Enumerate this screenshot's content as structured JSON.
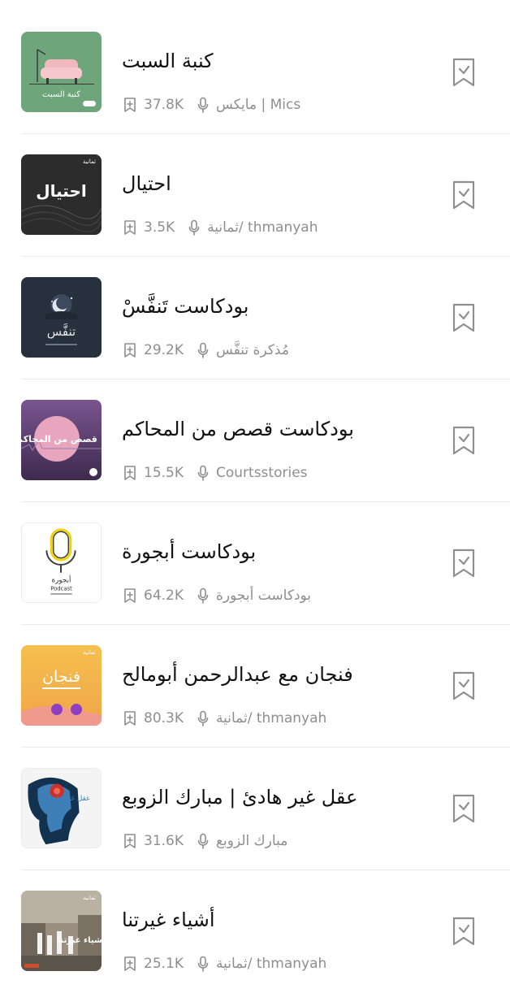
{
  "podcasts": [
    {
      "title": "كنبة السبت",
      "saves": "37.8K",
      "author": "مايكس | Mics",
      "cover": {
        "icon": "sofa-cover-art",
        "bg": "#6fa57b",
        "text": "كنبة السبت"
      }
    },
    {
      "title": "احتيال",
      "saves": "3.5K",
      "author": "ثمانية/ thmanyah",
      "cover": {
        "icon": "fingerprint-cover-art",
        "bg": "#2c2c2c",
        "text": "احتيال",
        "badge": "ثمانية"
      }
    },
    {
      "title": "بودكاست تَنفَّسْ",
      "saves": "29.2K",
      "author": "مُذكرة تنفَّس",
      "cover": {
        "icon": "moon-cover-art",
        "bg": "#27313d",
        "text": "تنفَّس"
      }
    },
    {
      "title": "بودكاست قصص من المحاكم",
      "saves": "15.5K",
      "author": "Courtsstories",
      "cover": {
        "icon": "purple-circle-cover-art",
        "bg": "#5b3f6e",
        "text": "قصص من المحاكم"
      }
    },
    {
      "title": "بودكاست أبجورة",
      "saves": "64.2K",
      "author": "بودكاست أبجورة",
      "cover": {
        "icon": "microphone-cover-art",
        "bg": "#ffffff",
        "text": "أبجورة",
        "subtext": "Podcast"
      }
    },
    {
      "title": "فنجان مع عبدالرحمن أبومالح",
      "saves": "80.3K",
      "author": "ثمانية/ thmanyah",
      "cover": {
        "icon": "fenjan-cover-art",
        "bg": "#f3b94f",
        "text": "فنجان",
        "badge": "ثمانية"
      }
    },
    {
      "title": "عقل غير هادئ | مبارك الزوبع",
      "saves": "31.6K",
      "author": "مبارك الزوبع",
      "cover": {
        "icon": "xray-skull-cover-art",
        "bg": "#f4f4f4",
        "text": "عقل غير هادئ"
      }
    },
    {
      "title": "أشياء غيرتنا",
      "saves": "25.1K",
      "author": "ثمانية/ thmanyah",
      "cover": {
        "icon": "street-photo-cover-art",
        "bg": "#9a8f80",
        "text": "أشياء غيرتنا",
        "badge": "ثمانية"
      }
    }
  ],
  "colors": {
    "meta_text": "#8e8e93",
    "title_text": "#111111",
    "bookmark_icon": "#8e8e93",
    "divider": "#ececee"
  }
}
